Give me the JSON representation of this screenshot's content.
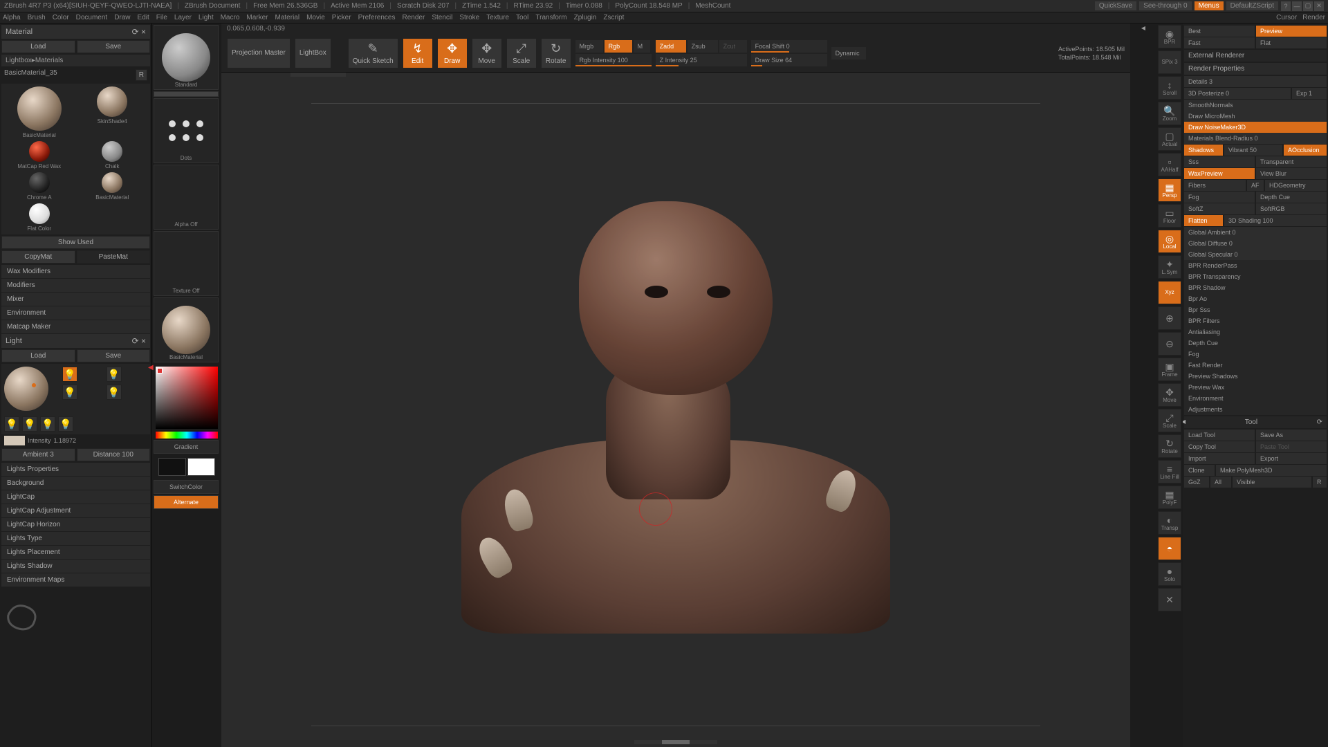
{
  "titlebar": {
    "app": "ZBrush 4R7 P3 (x64)[SIUH-QEYF-QWEO-LJTI-NAEA]",
    "doc": "ZBrush Document",
    "freemem": "Free Mem  26.536GB",
    "activemem": "Active Mem  2106",
    "scratch": "Scratch Disk  207",
    "ztime": "ZTime  1.542",
    "rtime": "RTime  23.92",
    "timer": "Timer  0.088",
    "polycount": "PolyCount  18.548 MP",
    "meshcount": "MeshCount",
    "quicksave": "QuickSave",
    "seethrough": "See-through  0",
    "menus": "Menus",
    "script": "DefaultZScript"
  },
  "menubar": [
    "Alpha",
    "Brush",
    "Color",
    "Document",
    "Draw",
    "Edit",
    "File",
    "Layer",
    "Light",
    "Macro",
    "Marker",
    "Material",
    "Movie",
    "Picker",
    "Preferences",
    "Render",
    "Stencil",
    "Stroke",
    "Texture",
    "Tool",
    "Transform",
    "Zplugin",
    "Zscript"
  ],
  "menubar_right": [
    "Cursor",
    "Render"
  ],
  "material": {
    "title": "Material",
    "load": "Load",
    "save": "Save",
    "path": "Lightbox▸Materials",
    "current": "BasicMaterial_35",
    "r": "R",
    "items": [
      {
        "name": "BasicMaterial"
      },
      {
        "name": "SkinShade4"
      },
      {
        "name": "MatCap Red Wax"
      },
      {
        "name": "Chalk"
      },
      {
        "name": "Chrome A"
      },
      {
        "name": "BasicMaterial"
      },
      {
        "name": "Flat Color"
      }
    ],
    "showused": "Show Used",
    "copymat": "CopyMat",
    "pastemat": "PasteMat",
    "sections": [
      "Wax Modifiers",
      "Modifiers",
      "Mixer",
      "Environment",
      "Matcap Maker"
    ]
  },
  "light": {
    "title": "Light",
    "load": "Load",
    "save": "Save",
    "intensity_label": "Intensity",
    "intensity": "1.18972",
    "ambient_label": "Ambient",
    "ambient": "3",
    "distance_label": "Distance",
    "distance": "100",
    "sections": [
      "Lights Properties",
      "Background",
      "LightCap",
      "LightCap Adjustment",
      "LightCap Horizon",
      "Lights Type",
      "Lights Placement",
      "Lights Shadow",
      "Environment Maps"
    ]
  },
  "toolcol": {
    "standard": "Standard",
    "dots": "Dots",
    "alphaoff": "Alpha Off",
    "texoff": "Texture Off",
    "basicmat": "BasicMaterial",
    "gradient": "Gradient",
    "switchcolor": "SwitchColor",
    "alternate": "Alternate"
  },
  "toolbar": {
    "coords": "0.065,0.608,-0.939",
    "projection": "Projection Master",
    "lightbox": "LightBox",
    "quicksketch": "Quick Sketch",
    "edit": "Edit",
    "draw": "Draw",
    "move": "Move",
    "scale": "Scale",
    "rotate": "Rotate",
    "mrgb": "Mrgb",
    "rgb": "Rgb",
    "m": "M",
    "rgbint": "Rgb Intensity 100",
    "zadd": "Zadd",
    "zsub": "Zsub",
    "zcut": "Zcut",
    "zint": "Z Intensity 25",
    "focal": "Focal Shift 0",
    "drawsize": "Draw Size 64",
    "dynamic": "Dynamic",
    "active": "ActivePoints: 18.505 Mil",
    "total": "TotalPoints: 18.548 Mil"
  },
  "quick": [
    {
      "l": "BPR",
      "ic": "◉"
    },
    {
      "l": "SPix 3",
      "ic": ""
    },
    {
      "l": "Scroll",
      "ic": "↕"
    },
    {
      "l": "Zoom",
      "ic": "🔍"
    },
    {
      "l": "Actual",
      "ic": "▢"
    },
    {
      "l": "AAHalf",
      "ic": "▫"
    },
    {
      "l": "Persp",
      "ic": "▦",
      "orange": true
    },
    {
      "l": "Floor",
      "ic": "▭"
    },
    {
      "l": "Local",
      "ic": "◎",
      "orange": true
    },
    {
      "l": "L.Sym",
      "ic": "✦"
    },
    {
      "l": "Xyz",
      "ic": "",
      "orange": true
    },
    {
      "l": "",
      "ic": "⊕"
    },
    {
      "l": "",
      "ic": "⊖"
    },
    {
      "l": "Frame",
      "ic": "▣"
    },
    {
      "l": "Move",
      "ic": "✥"
    },
    {
      "l": "Scale",
      "ic": "⤢"
    },
    {
      "l": "Rotate",
      "ic": "↻"
    },
    {
      "l": "Line Fill",
      "ic": "≡"
    },
    {
      "l": "PolyF",
      "ic": "▦"
    },
    {
      "l": "Transp",
      "ic": "◐"
    },
    {
      "l": "",
      "ic": "◓",
      "orange": true
    },
    {
      "l": "Solo",
      "ic": "●"
    },
    {
      "l": "",
      "ic": "✕"
    }
  ],
  "render": {
    "best": "Best",
    "preview": "Preview",
    "fast": "Fast",
    "flat": "Flat",
    "ext": "External Renderer",
    "props": "Render Properties",
    "details": "Details 3",
    "posterize": "3D Posterize 0",
    "exp": "Exp 1",
    "smooth": "SmoothNormals",
    "micro": "Draw MicroMesh",
    "noise": "Draw NoiseMaker3D",
    "blend": "Materials Blend-Radius 0",
    "shadows": "Shadows",
    "vibrant": "Vibrant 50",
    "ao": "AOcclusion",
    "sss": "Sss",
    "transparent": "Transparent",
    "waxprev": "WaxPreview",
    "viewblur": "View Blur",
    "fibers": "Fibers",
    "af": "AF",
    "hdgeo": "HDGeometry",
    "fog": "Fog",
    "depth": "Depth Cue",
    "softz": "SoftZ",
    "softrgb": "SoftRGB",
    "flatten": "Flatten",
    "shading": "3D Shading 100",
    "gamb": "Global Ambient 0",
    "gdif": "Global Diffuse 0",
    "gspec": "Global Specular 0",
    "sections": [
      "BPR RenderPass",
      "BPR Transparency",
      "BPR Shadow",
      "Bpr Ao",
      "Bpr Sss",
      "BPR Filters",
      "Antialiasing",
      "Depth Cue",
      "Fog",
      "Fast Render",
      "Preview Shadows",
      "Preview Wax",
      "Environment",
      "Adjustments"
    ]
  },
  "tool": {
    "title": "Tool",
    "loadtool": "Load Tool",
    "saveas": "Save As",
    "copytool": "Copy Tool",
    "pastetool": "Paste Tool",
    "import": "Import",
    "export": "Export",
    "clone": "Clone",
    "polymesh": "Make PolyMesh3D",
    "goz": "GoZ",
    "all": "All",
    "visible": "Visible",
    "r": "R"
  }
}
